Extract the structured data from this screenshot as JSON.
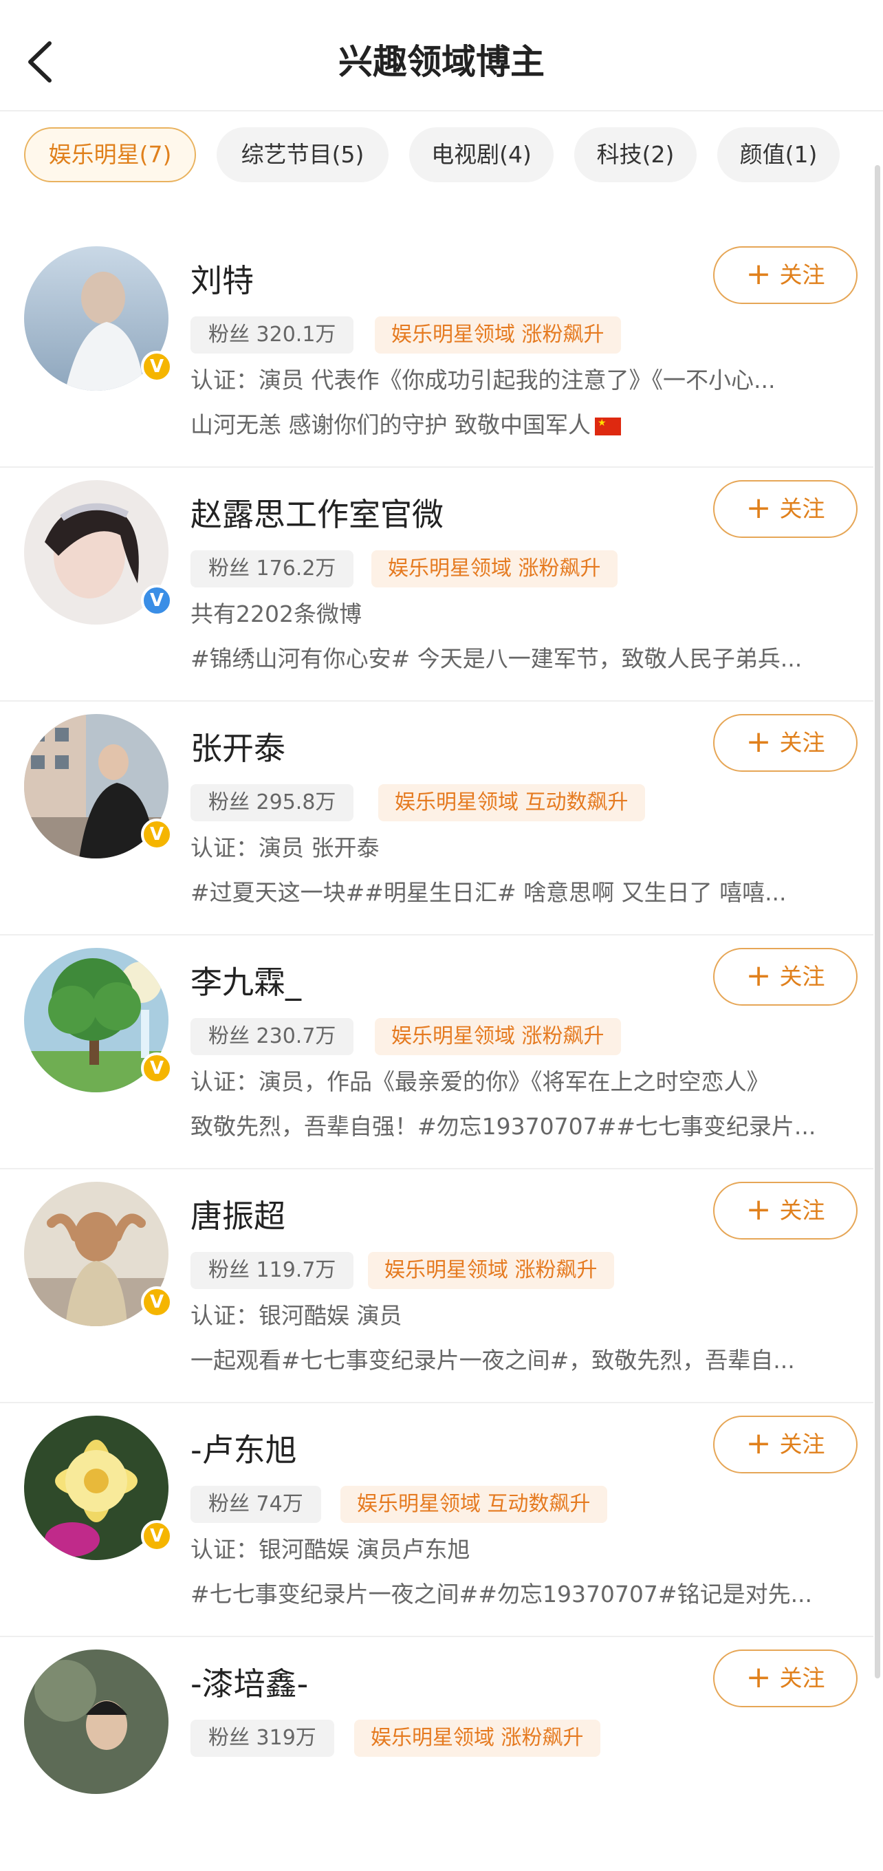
{
  "header": {
    "title": "兴趣领域博主",
    "back_icon": "chevron-left-icon"
  },
  "tabs": [
    {
      "label": "娱乐明星(7)",
      "active": true
    },
    {
      "label": "综艺节目(5)",
      "active": false
    },
    {
      "label": "电视剧(4)",
      "active": false
    },
    {
      "label": "科技(2)",
      "active": false
    },
    {
      "label": "颜值(1)",
      "active": false
    }
  ],
  "follow_label": "关注",
  "follow_icon": "plus-icon",
  "colors": {
    "accent": "#e0801c",
    "active_tab_bg": "#fff8ec",
    "verified_gold": "#f5b500",
    "verified_blue": "#3a8ee6"
  },
  "users": [
    {
      "name": "刘特",
      "fans": "粉丝 320.1万",
      "tag": "娱乐明星领域 涨粉飙升",
      "line1": "认证：演员 代表作《你成功引起我的注意了》《一不小心...",
      "line2": "山河无恙 感谢你们的守护 致敬中国军人",
      "line2_flag": true,
      "verified": "gold"
    },
    {
      "name": "赵露思工作室官微",
      "fans": "粉丝 176.2万",
      "tag": "娱乐明星领域 涨粉飙升",
      "line1": "共有2202条微博",
      "line2": "#锦绣山河有你心安# 今天是八一建军节，致敬人民子弟兵...",
      "verified": "blue"
    },
    {
      "name": "张开泰",
      "fans": "粉丝 295.8万",
      "tag": "娱乐明星领域 互动数飙升",
      "line1": "认证：演员 张开泰",
      "line2": "#过夏天这一块##明星生日汇# 啥意思啊 又生日了 嘻嘻...",
      "verified": "gold"
    },
    {
      "name": "李九霖_",
      "fans": "粉丝 230.7万",
      "tag": "娱乐明星领域 涨粉飙升",
      "line1": "认证：演员，作品《最亲爱的你》《将军在上之时空恋人》",
      "line2": "致敬先烈，吾辈自强！#勿忘19370707##七七事变纪录片...",
      "verified": "gold"
    },
    {
      "name": "唐振超",
      "fans": "粉丝 119.7万",
      "tag": "娱乐明星领域 涨粉飙升",
      "line1": "认证：银河酷娱 演员",
      "line2": "一起观看#七七事变纪录片一夜之间#，致敬先烈，吾辈自...",
      "verified": "gold"
    },
    {
      "name": "-卢东旭",
      "fans": "粉丝 74万",
      "tag": "娱乐明星领域 互动数飙升",
      "line1": "认证：银河酷娱 演员卢东旭",
      "line2": "#七七事变纪录片一夜之间##勿忘19370707#铭记是对先...",
      "verified": "gold"
    },
    {
      "name": "-漆培鑫-",
      "fans": "粉丝 319万",
      "tag": "娱乐明星领域 涨粉飙升",
      "line1": "",
      "line2": "",
      "verified": "gold"
    }
  ]
}
